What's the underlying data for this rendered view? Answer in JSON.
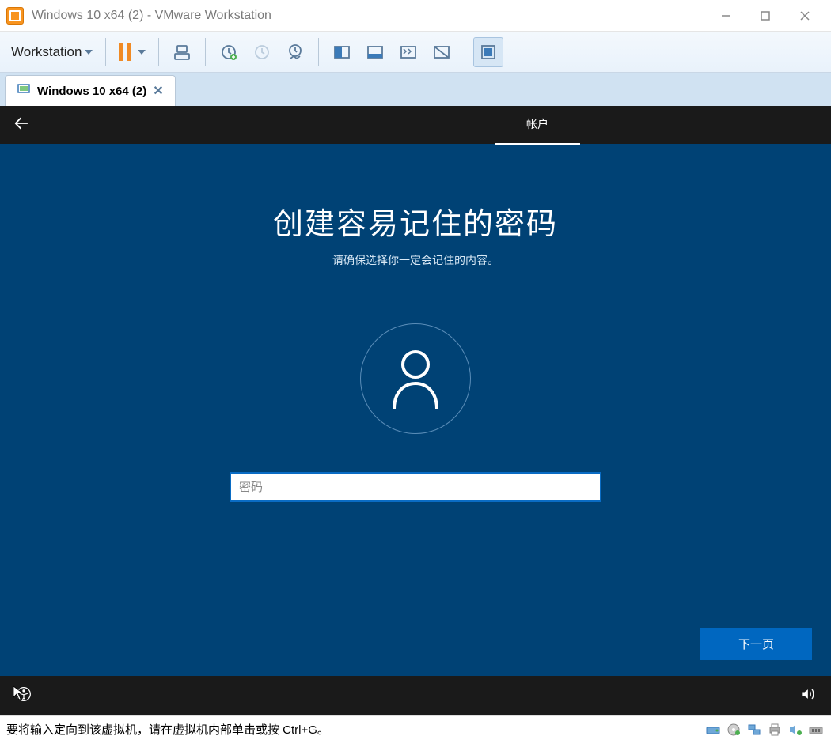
{
  "window": {
    "title": "Windows 10 x64 (2) - VMware Workstation"
  },
  "toolbar": {
    "menu_label": "Workstation"
  },
  "tab": {
    "label": "Windows 10 x64 (2)"
  },
  "oobe": {
    "account_tab": "帐户",
    "title": "创建容易记住的密码",
    "subtitle": "请确保选择你一定会记住的内容。",
    "password_placeholder": "密码",
    "next_button": "下一页"
  },
  "statusbar": {
    "message": "要将输入定向到该虚拟机，请在虚拟机内部单击或按 Ctrl+G。"
  }
}
